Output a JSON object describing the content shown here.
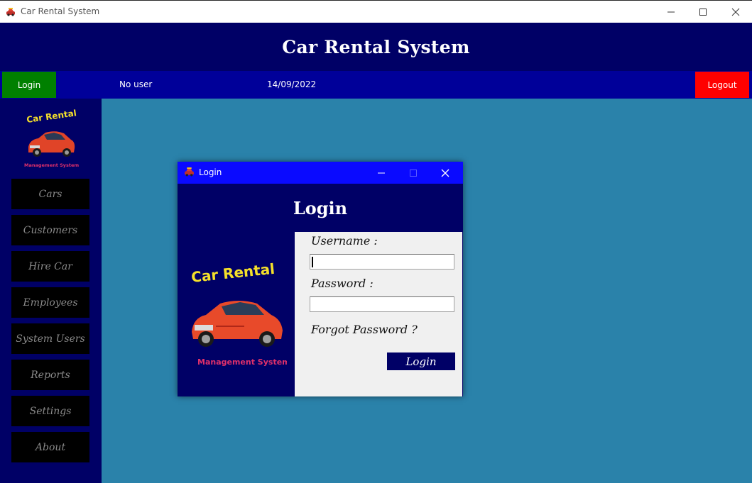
{
  "window": {
    "title": "Car Rental System",
    "icon": "car-icon"
  },
  "header": {
    "title": "Car Rental System"
  },
  "statusbar": {
    "login_label": "Login",
    "user": "No user",
    "date": "14/09/2022",
    "logout_label": "Logout",
    "colors": {
      "login": "#008000",
      "logout": "#ff0000",
      "bar": "#000099"
    }
  },
  "logo": {
    "line1": "Car Rental",
    "line2": "Management System"
  },
  "sidebar": {
    "items": [
      {
        "label": "Cars"
      },
      {
        "label": "Customers"
      },
      {
        "label": "Hire Car"
      },
      {
        "label": "Employees"
      },
      {
        "label": "System Users"
      },
      {
        "label": "Reports"
      },
      {
        "label": "Settings"
      },
      {
        "label": "About"
      }
    ]
  },
  "dialog": {
    "title": "Login",
    "heading": "Login",
    "username_label": "Username :",
    "username_value": "",
    "password_label": "Password :",
    "password_value": "",
    "forgot_label": "Forgot Password ?",
    "login_button": "Login"
  }
}
